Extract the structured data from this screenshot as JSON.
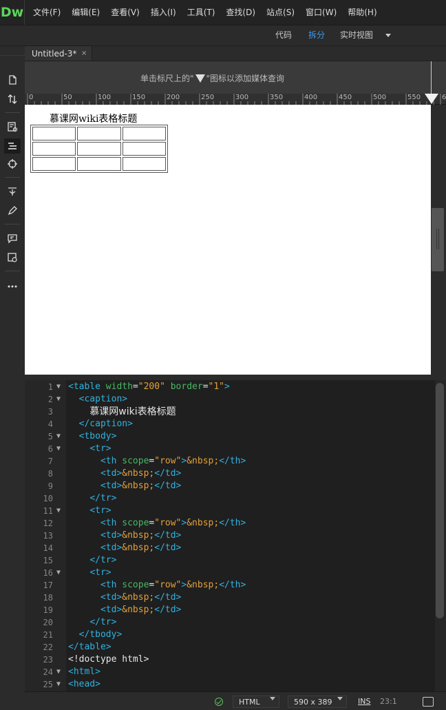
{
  "app": {
    "logo": "Dw"
  },
  "menu": [
    {
      "label": "文件(F)"
    },
    {
      "label": "编辑(E)"
    },
    {
      "label": "查看(V)"
    },
    {
      "label": "插入(I)"
    },
    {
      "label": "工具(T)"
    },
    {
      "label": "查找(D)"
    },
    {
      "label": "站点(S)"
    },
    {
      "label": "窗口(W)"
    },
    {
      "label": "帮助(H)"
    }
  ],
  "view_modes": {
    "code": "代码",
    "split": "拆分",
    "live": "实时视图",
    "active": "拆分"
  },
  "document_tab": {
    "title": "Untitled-3*",
    "close": "×"
  },
  "media_query_bar": {
    "text_before": "单击标尺上的\"",
    "text_after": "\"图标以添加媒体查询"
  },
  "ruler": {
    "ticks": [
      "0",
      "50",
      "100",
      "150",
      "200",
      "250",
      "300",
      "350",
      "400",
      "450",
      "500",
      "550",
      "6"
    ]
  },
  "design_view": {
    "caption": "慕课网wiki表格标题",
    "rows": 3,
    "cols": 3
  },
  "code_lines": [
    {
      "n": "1",
      "fold": true,
      "tokens": [
        [
          "tag",
          "<table "
        ],
        [
          "attr",
          "width"
        ],
        [
          "plain",
          "="
        ],
        [
          "val",
          "\"200\""
        ],
        [
          "plain",
          " "
        ],
        [
          "attr",
          "border"
        ],
        [
          "plain",
          "="
        ],
        [
          "val",
          "\"1\""
        ],
        [
          "tag",
          ">"
        ]
      ]
    },
    {
      "n": "2",
      "fold": true,
      "tokens": [
        [
          "plain",
          "  "
        ],
        [
          "tag",
          "<caption>"
        ]
      ]
    },
    {
      "n": "3",
      "fold": false,
      "tokens": [
        [
          "plain",
          "    "
        ],
        [
          "cjk",
          "慕课网wiki表格标题"
        ]
      ]
    },
    {
      "n": "4",
      "fold": false,
      "tokens": [
        [
          "plain",
          "  "
        ],
        [
          "tag",
          "</caption>"
        ]
      ]
    },
    {
      "n": "5",
      "fold": true,
      "tokens": [
        [
          "plain",
          "  "
        ],
        [
          "tag",
          "<tbody>"
        ]
      ]
    },
    {
      "n": "6",
      "fold": true,
      "tokens": [
        [
          "plain",
          "    "
        ],
        [
          "tag",
          "<tr>"
        ]
      ]
    },
    {
      "n": "7",
      "fold": false,
      "tokens": [
        [
          "plain",
          "      "
        ],
        [
          "tag",
          "<th "
        ],
        [
          "attr",
          "scope"
        ],
        [
          "plain",
          "="
        ],
        [
          "val",
          "\"row\""
        ],
        [
          "tag",
          ">"
        ],
        [
          "ent",
          "&nbsp;"
        ],
        [
          "tag",
          "</th>"
        ]
      ]
    },
    {
      "n": "8",
      "fold": false,
      "tokens": [
        [
          "plain",
          "      "
        ],
        [
          "tag",
          "<td>"
        ],
        [
          "ent",
          "&nbsp;"
        ],
        [
          "tag",
          "</td>"
        ]
      ]
    },
    {
      "n": "9",
      "fold": false,
      "tokens": [
        [
          "plain",
          "      "
        ],
        [
          "tag",
          "<td>"
        ],
        [
          "ent",
          "&nbsp;"
        ],
        [
          "tag",
          "</td>"
        ]
      ]
    },
    {
      "n": "10",
      "fold": false,
      "tokens": [
        [
          "plain",
          "    "
        ],
        [
          "tag",
          "</tr>"
        ]
      ]
    },
    {
      "n": "11",
      "fold": true,
      "tokens": [
        [
          "plain",
          "    "
        ],
        [
          "tag",
          "<tr>"
        ]
      ]
    },
    {
      "n": "12",
      "fold": false,
      "tokens": [
        [
          "plain",
          "      "
        ],
        [
          "tag",
          "<th "
        ],
        [
          "attr",
          "scope"
        ],
        [
          "plain",
          "="
        ],
        [
          "val",
          "\"row\""
        ],
        [
          "tag",
          ">"
        ],
        [
          "ent",
          "&nbsp;"
        ],
        [
          "tag",
          "</th>"
        ]
      ]
    },
    {
      "n": "13",
      "fold": false,
      "tokens": [
        [
          "plain",
          "      "
        ],
        [
          "tag",
          "<td>"
        ],
        [
          "ent",
          "&nbsp;"
        ],
        [
          "tag",
          "</td>"
        ]
      ]
    },
    {
      "n": "14",
      "fold": false,
      "tokens": [
        [
          "plain",
          "      "
        ],
        [
          "tag",
          "<td>"
        ],
        [
          "ent",
          "&nbsp;"
        ],
        [
          "tag",
          "</td>"
        ]
      ]
    },
    {
      "n": "15",
      "fold": false,
      "tokens": [
        [
          "plain",
          "    "
        ],
        [
          "tag",
          "</tr>"
        ]
      ]
    },
    {
      "n": "16",
      "fold": true,
      "tokens": [
        [
          "plain",
          "    "
        ],
        [
          "tag",
          "<tr>"
        ]
      ]
    },
    {
      "n": "17",
      "fold": false,
      "tokens": [
        [
          "plain",
          "      "
        ],
        [
          "tag",
          "<th "
        ],
        [
          "attr",
          "scope"
        ],
        [
          "plain",
          "="
        ],
        [
          "val",
          "\"row\""
        ],
        [
          "tag",
          ">"
        ],
        [
          "ent",
          "&nbsp;"
        ],
        [
          "tag",
          "</th>"
        ]
      ]
    },
    {
      "n": "18",
      "fold": false,
      "tokens": [
        [
          "plain",
          "      "
        ],
        [
          "tag",
          "<td>"
        ],
        [
          "ent",
          "&nbsp;"
        ],
        [
          "tag",
          "</td>"
        ]
      ]
    },
    {
      "n": "19",
      "fold": false,
      "tokens": [
        [
          "plain",
          "      "
        ],
        [
          "tag",
          "<td>"
        ],
        [
          "ent",
          "&nbsp;"
        ],
        [
          "tag",
          "</td>"
        ]
      ]
    },
    {
      "n": "20",
      "fold": false,
      "tokens": [
        [
          "plain",
          "    "
        ],
        [
          "tag",
          "</tr>"
        ]
      ]
    },
    {
      "n": "21",
      "fold": false,
      "tokens": [
        [
          "plain",
          "  "
        ],
        [
          "tag",
          "</tbody>"
        ]
      ]
    },
    {
      "n": "22",
      "fold": false,
      "tokens": [
        [
          "tag",
          "</table>"
        ]
      ]
    },
    {
      "n": "23",
      "fold": false,
      "tokens": [
        [
          "plain",
          "<!doctype html>"
        ]
      ]
    },
    {
      "n": "24",
      "fold": true,
      "tokens": [
        [
          "tag",
          "<html>"
        ]
      ]
    },
    {
      "n": "25",
      "fold": true,
      "tokens": [
        [
          "tag",
          "<head>"
        ]
      ]
    }
  ],
  "status": {
    "language": "HTML",
    "size": "590 x 389",
    "mode": "INS",
    "cursor": "23:1"
  },
  "colors": {
    "accent": "#3d9bf2",
    "logo": "#5cd35c",
    "tag": "#2fb3e0",
    "attr": "#48b863",
    "value": "#e3a03a"
  },
  "icons": [
    "new-file-icon",
    "sort-icon",
    "file-manage-icon",
    "structure-icon",
    "target-icon",
    "snippets-icon",
    "pen-icon",
    "comment-icon",
    "code-check-icon",
    "more-icon",
    "ok-status-icon",
    "preview-icon",
    "fold-arrow-icon",
    "dropdown-caret-icon",
    "media-query-icon"
  ]
}
